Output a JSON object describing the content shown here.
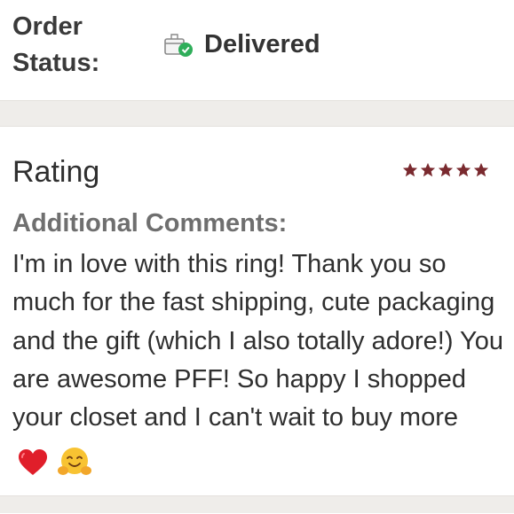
{
  "order": {
    "label_line1": "Order",
    "label_line2": "Status:",
    "status_icon": "package-delivered-icon",
    "status": "Delivered"
  },
  "review": {
    "rating_label": "Rating",
    "stars": 5,
    "star_color": "#7a2a2f",
    "comments_heading": "Additional Comments:",
    "comments_text": "I'm in love with this ring! Thank you so much for the fast shipping, cute packaging and the gift (which I also totally adore!) You are awesome PFF! So happy I shopped your closet and I can't wait to buy more",
    "emojis": [
      "red-heart-icon",
      "hugging-face-icon"
    ]
  }
}
